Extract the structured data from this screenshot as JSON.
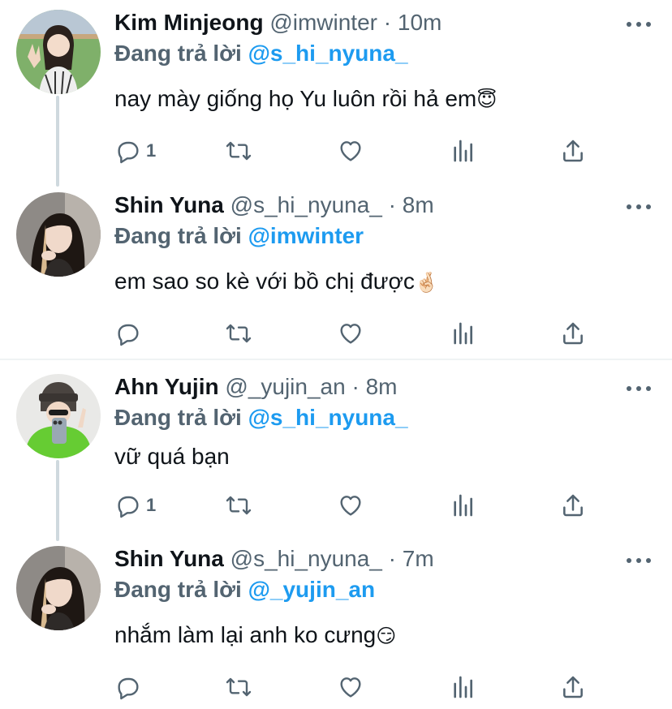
{
  "tweets": [
    {
      "name": "Kim Minjeong",
      "handle": "@imwinter",
      "time": "· 10m",
      "reply_prefix": "Đang trả lời",
      "reply_to": "@s_hi_nyuna_",
      "text": "nay mày giống họ Yu luôn rồi hả em",
      "emoji": "😇",
      "reply_count": "1"
    },
    {
      "name": "Shin Yuna",
      "handle": "@s_hi_nyuna_",
      "time": "· 8m",
      "reply_prefix": "Đang trả lời",
      "reply_to": "@imwinter",
      "text": "em sao so kè với bồ chị được",
      "emoji": "🤞🏻",
      "reply_count": ""
    },
    {
      "name": "Ahn Yujin",
      "handle": "@_yujin_an",
      "time": "· 8m",
      "reply_prefix": "Đang trả lời",
      "reply_to": "@s_hi_nyuna_",
      "text": "vữ quá bạn",
      "emoji": "",
      "reply_count": "1"
    },
    {
      "name": "Shin Yuna",
      "handle": "@s_hi_nyuna_",
      "time": "· 7m",
      "reply_prefix": "Đang trả lời",
      "reply_to": "@_yujin_an",
      "text": "nhắm làm lại anh ko cưng",
      "emoji": "😏",
      "reply_count": ""
    }
  ],
  "colors": {
    "link": "#1d9bf0",
    "secondary_text": "#536471",
    "primary_text": "#0f1419",
    "thread_line": "#cfd9de",
    "divider": "#eff3f4"
  },
  "icons": [
    "reply-icon",
    "retweet-icon",
    "like-icon",
    "views-icon",
    "share-icon",
    "more-icon"
  ]
}
